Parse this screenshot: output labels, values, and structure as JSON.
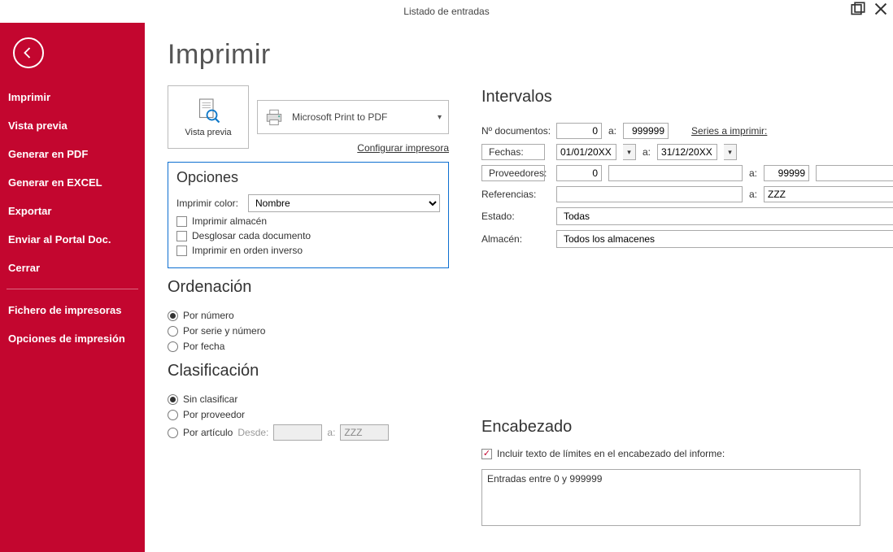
{
  "window": {
    "title": "Listado de entradas"
  },
  "page": {
    "heading": "Imprimir"
  },
  "sidebar": {
    "items": [
      "Imprimir",
      "Vista previa",
      "Generar en PDF",
      "Generar en EXCEL",
      "Exportar",
      "Enviar al Portal Doc.",
      "Cerrar"
    ],
    "secondary": [
      "Fichero de impresoras",
      "Opciones de impresión"
    ]
  },
  "preview": {
    "label": "Vista previa",
    "printer_name": "Microsoft Print to PDF",
    "config_link": "Configurar impresora"
  },
  "opciones": {
    "title": "Opciones",
    "color_label": "Imprimir color:",
    "color_value": "Nombre",
    "chk_almacen": "Imprimir almacén",
    "chk_desglosar": "Desglosar cada documento",
    "chk_inverso": "Imprimir en orden inverso"
  },
  "ordenacion": {
    "title": "Ordenación",
    "por_numero": "Por número",
    "por_serie": "Por serie y número",
    "por_fecha": "Por fecha"
  },
  "clasificacion": {
    "title": "Clasificación",
    "sin_clasificar": "Sin clasificar",
    "por_proveedor": "Por proveedor",
    "por_articulo": "Por artículo",
    "desde_label": "Desde:",
    "a_label": "a:",
    "desde_val": "",
    "a_val": "ZZZ"
  },
  "intervalos": {
    "title": "Intervalos",
    "ndoc_label": "Nº documentos:",
    "ndoc_from": "0",
    "ndoc_a": "a:",
    "ndoc_to": "999999",
    "series_link": "Series a imprimir:",
    "fechas_btn": "Fechas:",
    "fecha_from": "01/01/20XX",
    "fecha_a": "a:",
    "fecha_to": "31/12/20XX",
    "prov_btn": "Proveedores:",
    "prov_from": "0",
    "prov_a": "a:",
    "prov_to": "99999",
    "ref_label": "Referencias:",
    "ref_from": "",
    "ref_a": "a:",
    "ref_to": "ZZZ",
    "estado_label": "Estado:",
    "estado_value": "Todas",
    "almacen_label": "Almacén:",
    "almacen_value": "Todos los almacenes"
  },
  "encabezado": {
    "title": "Encabezado",
    "chk_label": "Incluir texto de límites en el encabezado del informe:",
    "text": "Entradas entre 0 y 999999"
  }
}
